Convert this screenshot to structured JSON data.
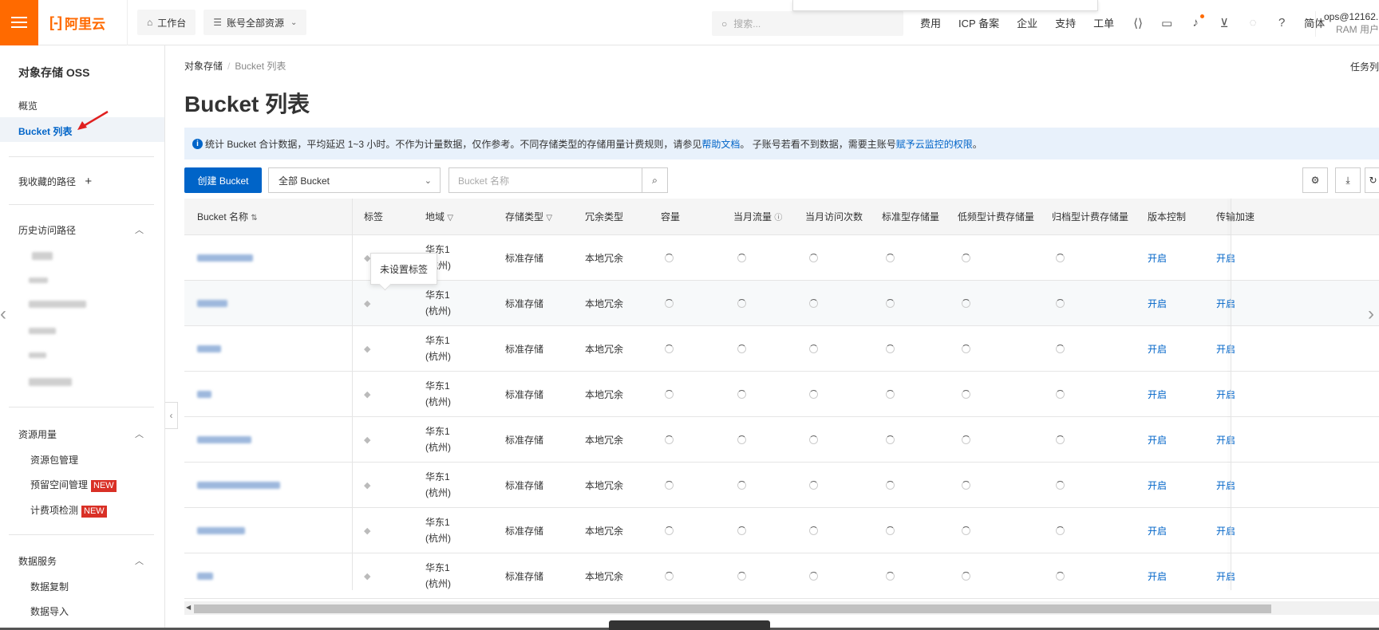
{
  "topbar": {
    "logo": "阿里云",
    "workbench": "工作台",
    "resources": "账号全部资源",
    "search_placeholder": "搜索...",
    "nav": [
      "费用",
      "ICP 备案",
      "企业",
      "支持",
      "工单"
    ],
    "lang": "简体",
    "user_line1": "ops@12162...",
    "user_line2": "RAM 用户"
  },
  "sidebar": {
    "title": "对象存储 OSS",
    "overview": "概览",
    "bucket_list": "Bucket 列表",
    "favorites": "我收藏的路径",
    "history": "历史访问路径",
    "resource_usage": "资源用量",
    "resource_items": [
      "资源包管理",
      "预留空间管理",
      "计费项检测"
    ],
    "new_tag": "NEW",
    "data_services": "数据服务",
    "data_items": [
      "数据复制",
      "数据导入"
    ]
  },
  "main": {
    "breadcrumb_root": "对象存储",
    "breadcrumb_current": "Bucket 列表",
    "task_list": "任务列",
    "title": "Bucket 列表",
    "notice_pre": "统计 Bucket 合计数据，平均延迟 1~3 小时。不作为计量数据，仅作参考。不同存储类型的存储用量计费规则，请参见",
    "notice_link1": "帮助文档",
    "notice_mid": "。 子账号若看不到数据，需要主账号",
    "notice_link2": "赋予云监控的权限",
    "notice_end": "。",
    "create_button": "创建 Bucket",
    "filter_select": "全部 Bucket",
    "filter_placeholder": "Bucket 名称"
  },
  "table": {
    "headers": [
      "Bucket 名称",
      "标签",
      "地域",
      "存储类型",
      "冗余类型",
      "容量",
      "当月流量",
      "当月访问次数",
      "标准型存储量",
      "低频型计费存储量",
      "归档型计费存储量",
      "版本控制",
      "传输加速"
    ],
    "tooltip": "未设置标签",
    "rows": [
      {
        "name": "",
        "region1": "华东1",
        "region2": "(杭州)",
        "storage": "标准存储",
        "redundancy": "本地冗余",
        "version": "开启",
        "accel": "开启"
      },
      {
        "name": "",
        "region1": "华东1",
        "region2": "(杭州)",
        "storage": "标准存储",
        "redundancy": "本地冗余",
        "version": "开启",
        "accel": "开启"
      },
      {
        "name": "",
        "region1": "华东1",
        "region2": "(杭州)",
        "storage": "标准存储",
        "redundancy": "本地冗余",
        "version": "开启",
        "accel": "开启"
      },
      {
        "name": "",
        "region1": "华东1",
        "region2": "(杭州)",
        "storage": "标准存储",
        "redundancy": "本地冗余",
        "version": "开启",
        "accel": "开启"
      },
      {
        "name": "",
        "region1": "华东1",
        "region2": "(杭州)",
        "storage": "标准存储",
        "redundancy": "本地冗余",
        "version": "开启",
        "accel": "开启"
      },
      {
        "name": "",
        "region1": "华东1",
        "region2": "(杭州)",
        "storage": "标准存储",
        "redundancy": "本地冗余",
        "version": "开启",
        "accel": "开启"
      },
      {
        "name": "",
        "region1": "华东1",
        "region2": "(杭州)",
        "storage": "标准存储",
        "redundancy": "本地冗余",
        "version": "开启",
        "accel": "开启"
      },
      {
        "name": "",
        "region1": "华东1",
        "region2": "(杭州)",
        "storage": "标准存储",
        "redundancy": "本地冗余",
        "version": "开启",
        "accel": "开启"
      }
    ]
  },
  "colors": {
    "brand": "#ff6a00",
    "primary": "#0064c8",
    "new_tag": "#d93026"
  }
}
